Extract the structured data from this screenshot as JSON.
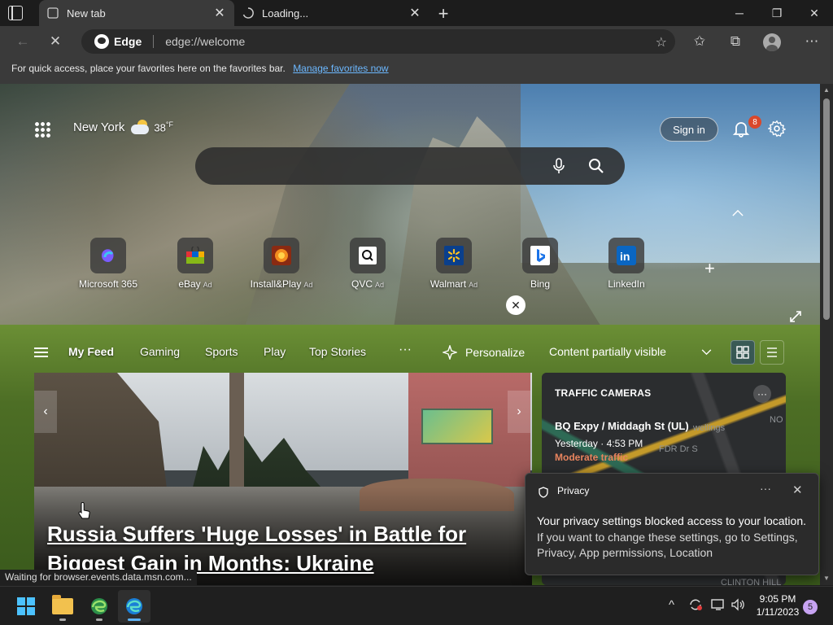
{
  "tabs": [
    {
      "title": "New tab",
      "close": "✕"
    },
    {
      "title": "Loading...",
      "close": "✕"
    }
  ],
  "window": {
    "minimize": "─",
    "restore": "❐",
    "close": "✕",
    "new_tab": "+"
  },
  "toolbar": {
    "back": "←",
    "stop": "✕",
    "brand": "Edge",
    "url": "edge://welcome",
    "star": "☆",
    "favorites": "✩",
    "collections": "⧉",
    "more": "⋯"
  },
  "favbar": {
    "message": "For quick access, place your favorites here on the favorites bar.",
    "link": "Manage favorites now"
  },
  "weather": {
    "city": "New York",
    "temp": "38",
    "unit": "°F"
  },
  "header": {
    "sign_in": "Sign in",
    "notification_count": "8"
  },
  "search": {
    "placeholder": ""
  },
  "quicklinks": [
    {
      "label": "Microsoft 365",
      "ad": "",
      "icon": "microsoft-365-icon"
    },
    {
      "label": "eBay",
      "ad": "Ad",
      "icon": "ebay-icon"
    },
    {
      "label": "Install&Play",
      "ad": "Ad",
      "icon": "install-play-icon"
    },
    {
      "label": "QVC",
      "ad": "Ad",
      "icon": "qvc-icon"
    },
    {
      "label": "Walmart",
      "ad": "Ad",
      "icon": "walmart-icon"
    },
    {
      "label": "Bing",
      "ad": "",
      "icon": "bing-icon"
    },
    {
      "label": "LinkedIn",
      "ad": "",
      "icon": "linkedin-icon"
    }
  ],
  "quicklinks_add": "+",
  "feed_nav": {
    "items": [
      "My Feed",
      "Gaming",
      "Sports",
      "Play",
      "Top Stories"
    ],
    "more": "···",
    "personalize": "Personalize",
    "content_visibility": "Content partially visible"
  },
  "hero": {
    "headline": "Russia Suffers 'Huge Losses' in Battle for Biggest Gain in Months: Ukraine",
    "close": "✕",
    "prev": "‹",
    "next": "›"
  },
  "traffic": {
    "title": "TRAFFIC CAMERAS",
    "more": "···",
    "road": "BQ Expy / Middagh St (UL)",
    "time": "Yesterday · 4:53 PM",
    "condition": "Moderate traffic",
    "map_labels": [
      "wellings",
      "FDR Dr S",
      "CLINTON HILL",
      "NO"
    ]
  },
  "privacy": {
    "title": "Privacy",
    "more": "···",
    "close": "✕",
    "message": "Your privacy settings blocked access to your location.",
    "detail": "If you want to change these settings, go to Settings, Privacy, App permissions, Location"
  },
  "status": {
    "text": "Waiting for browser.events.data.msn.com..."
  },
  "taskbar": {
    "time": "9:05 PM",
    "date": "1/11/2023",
    "notifications": "5",
    "tray_chevron": "^"
  },
  "colors": {
    "accent": "#6cb8ff",
    "badge": "#d9482b",
    "traffic_moderate": "#e8845e",
    "notif": "#c7a3f2"
  }
}
